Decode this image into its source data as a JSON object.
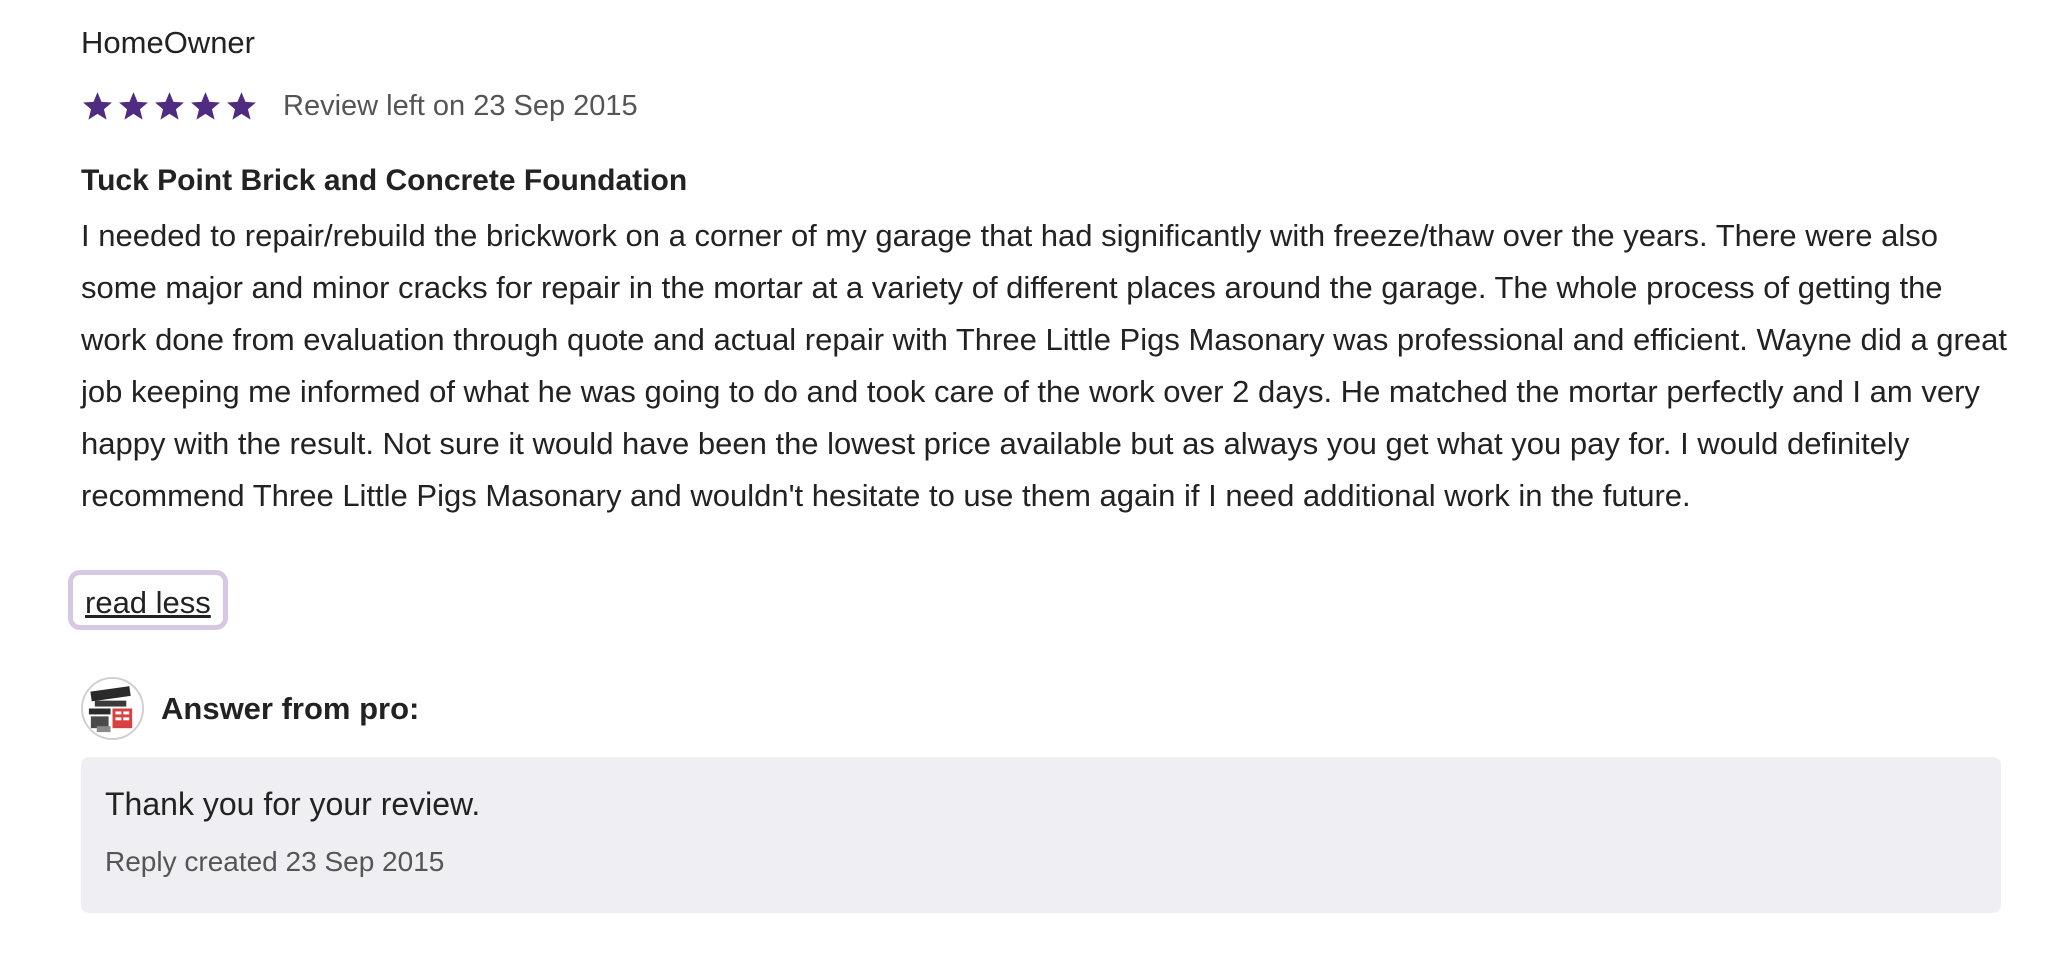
{
  "review": {
    "reviewer": "HomeOwner",
    "rating": 5,
    "rating_max": 5,
    "date_text": "Review left on 23 Sep 2015",
    "title": "Tuck Point Brick and Concrete Foundation",
    "body": "I needed to repair/rebuild the brickwork on a corner of my garage that had significantly with freeze/thaw over the years. There were also some major and minor cracks for repair in the mortar at a variety of different places around the garage. The whole process of getting the work done from evaluation through quote and actual repair with Three Little Pigs Masonary was professional and efficient. Wayne did a great job keeping me informed of what he was going to do and took care of the work over 2 days. He matched the mortar perfectly and I am very happy with the result. Not sure it would have been the lowest price available but as always you get what you pay for. I would definitely recommend Three Little Pigs Masonary and wouldn't hesitate to use them again if I need additional work in the future.",
    "read_less_label": "read less",
    "star_color": "#4f2b82"
  },
  "pro_answer": {
    "label": "Answer from pro:",
    "avatar_icon": "company-logo-avatar",
    "reply_text": "Thank you for your review.",
    "reply_date_text": "Reply created 23 Sep 2015"
  }
}
